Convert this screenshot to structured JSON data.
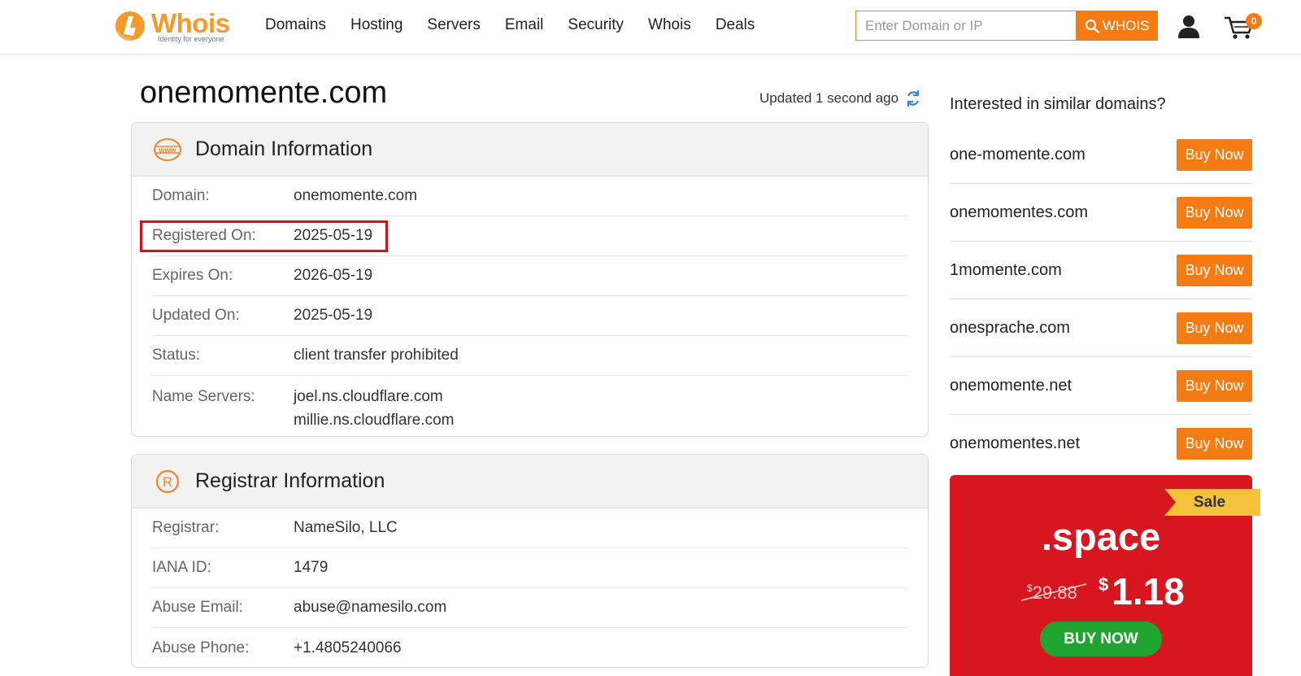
{
  "brand": {
    "name": "Whois",
    "tagline": "Identity for everyone"
  },
  "nav": [
    "Domains",
    "Hosting",
    "Servers",
    "Email",
    "Security",
    "Whois",
    "Deals"
  ],
  "search": {
    "placeholder": "Enter Domain or IP",
    "button_label": "WHOIS"
  },
  "cart": {
    "count": "0"
  },
  "page": {
    "title": "onemomente.com",
    "updated": "Updated 1 second ago"
  },
  "domain_info": {
    "title": "Domain Information",
    "icon": "www-icon",
    "rows": [
      {
        "label": "Domain:",
        "value": "onemomente.com"
      },
      {
        "label": "Registered On:",
        "value": "2025-05-19"
      },
      {
        "label": "Expires On:",
        "value": "2026-05-19"
      },
      {
        "label": "Updated On:",
        "value": "2025-05-19"
      },
      {
        "label": "Status:",
        "value": "client transfer prohibited"
      },
      {
        "label": "Name Servers:",
        "values": [
          "joel.ns.cloudflare.com",
          "millie.ns.cloudflare.com"
        ]
      }
    ]
  },
  "registrar_info": {
    "title": "Registrar Information",
    "icon": "registered-icon",
    "rows": [
      {
        "label": "Registrar:",
        "value": "NameSilo, LLC"
      },
      {
        "label": "IANA ID:",
        "value": "1479"
      },
      {
        "label": "Abuse Email:",
        "value": "abuse@namesilo.com"
      },
      {
        "label": "Abuse Phone:",
        "value": "+1.4805240066"
      }
    ]
  },
  "similar": {
    "title": "Interested in similar domains?",
    "button_label": "Buy Now",
    "items": [
      "one-momente.com",
      "onemomentes.com",
      "1momente.com",
      "onesprache.com",
      "onemomente.net",
      "onemomentes.net"
    ]
  },
  "promo": {
    "badge": "Sale",
    "tld": ".space",
    "old_price": "29.88",
    "new_price": "1.18",
    "currency": "$",
    "button_label": "BUY NOW"
  },
  "colors": {
    "accent": "#f57c14",
    "promo_bg": "#d7161f",
    "promo_button": "#1fa52f",
    "highlight": "#d0121b"
  }
}
